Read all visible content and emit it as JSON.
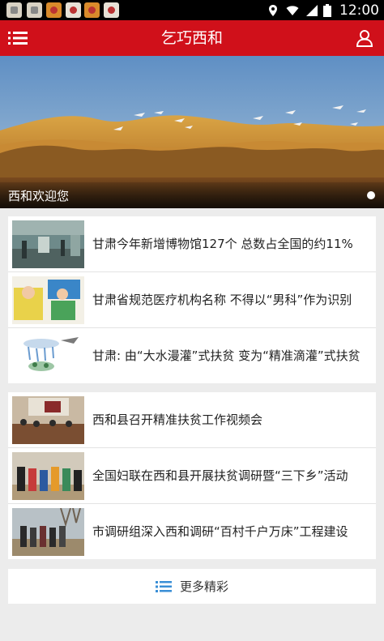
{
  "status_bar": {
    "time": "12:00",
    "icons": [
      "notification-icon",
      "notification-icon",
      "notification-icon",
      "notification-icon",
      "notification-icon",
      "notification-icon",
      "location-icon",
      "wifi-icon",
      "signal-icon",
      "battery-icon"
    ]
  },
  "header": {
    "title": "乞巧西和",
    "left_icon": "menu-icon",
    "right_icon": "user-icon",
    "background": "#d0101a"
  },
  "banner": {
    "caption": "西和欢迎您"
  },
  "news_group_1": [
    {
      "title": "甘肃今年新增博物馆127个 总数占全国的约11%"
    },
    {
      "title": "甘肃省规范医疗机构名称 不得以“男科”作为识别"
    },
    {
      "title": "甘肃: 由“大水漫灌”式扶贫 变为“精准滴灌”式扶贫"
    }
  ],
  "news_group_2": [
    {
      "title": "西和县召开精准扶贫工作视频会"
    },
    {
      "title": "全国妇联在西和县开展扶贫调研暨“三下乡”活动"
    },
    {
      "title": "市调研组深入西和调研“百村千户万床”工程建设"
    }
  ],
  "more": {
    "label": "更多精彩",
    "icon": "list-icon"
  }
}
